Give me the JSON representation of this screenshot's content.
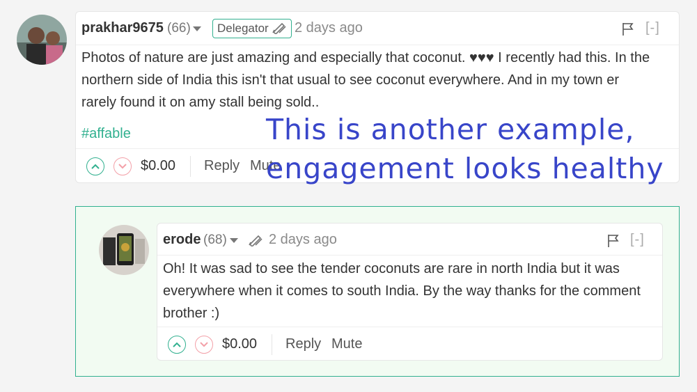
{
  "comment": {
    "author": "prakhar9675",
    "reputation": "(66)",
    "badge_label": "Delegator",
    "time": "2 days ago",
    "collapse_label": "[-]",
    "body_lines": [
      "Photos of nature are just amazing and especially that coconut. ♥♥♥ I recently had this. In the",
      "northern side of India this isn't that usual to see coconut everywhere. And in my town er",
      "rarely found it on amy stall being sold.."
    ],
    "tag": "#affable",
    "payout": "$0.00",
    "reply_label": "Reply",
    "mute_label": "Mute"
  },
  "reply": {
    "author": "erode",
    "reputation": "(68)",
    "time": "2 days ago",
    "collapse_label": "[-]",
    "body_lines": [
      "Oh! It was sad to see the tender coconuts are rare in north India but it was",
      "everywhere when it comes to south India. By the way thanks for the comment",
      "brother :)"
    ],
    "payout": "$0.00",
    "reply_label": "Reply",
    "mute_label": "Mute"
  },
  "overlay": {
    "line1": "This is another example,",
    "line2": "engagement looks healthy"
  },
  "colors": {
    "accent": "#31b08f",
    "downvote": "#f3a0a8",
    "overlay_text": "#3845c9",
    "reply_bg": "#f2fbf2"
  },
  "icons": {
    "caret": "chevron-down-icon",
    "badge": "pen-icon",
    "flag": "flag-icon",
    "upvote": "chevron-up-icon",
    "downvote": "chevron-down-icon"
  }
}
